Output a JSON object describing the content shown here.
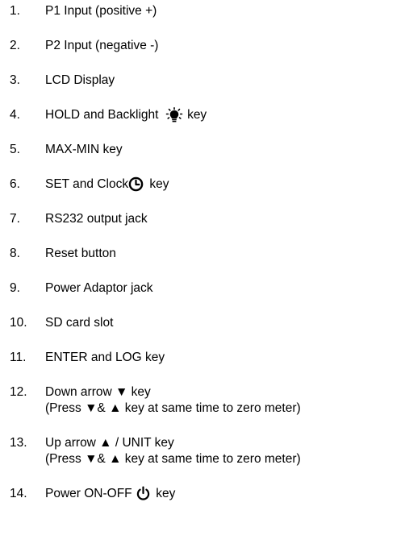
{
  "items": [
    {
      "num": "1.",
      "text": "P1 Input (positive +)"
    },
    {
      "num": "2.",
      "text": "P2 Input (negative -)"
    },
    {
      "num": "3.",
      "text": "LCD Display"
    },
    {
      "num": "4.",
      "text_before": "HOLD and Backlight",
      "icon": "lightbulb-icon",
      "text_after": "key"
    },
    {
      "num": "5.",
      "text": "MAX-MIN key"
    },
    {
      "num": "6.",
      "text_before": "SET and Clock",
      "icon": "clock-icon",
      "text_after": "key"
    },
    {
      "num": "7.",
      "text": "RS232 output jack"
    },
    {
      "num": "8.",
      "text": "Reset button"
    },
    {
      "num": "9.",
      "text": "Power Adaptor jack"
    },
    {
      "num": "10.",
      "text": "SD card slot"
    },
    {
      "num": "11.",
      "text": "ENTER and LOG key"
    },
    {
      "num": "12.",
      "text": "Down arrow ▼ key",
      "note": "(Press ▼& ▲ key at same time to zero meter)"
    },
    {
      "num": "13.",
      "text": "Up arrow ▲ / UNIT key",
      "note": "(Press ▼& ▲ key at same time to zero meter)"
    },
    {
      "num": "14.",
      "text_before": "Power ON-OFF",
      "icon": "power-icon",
      "text_after": "key"
    }
  ]
}
